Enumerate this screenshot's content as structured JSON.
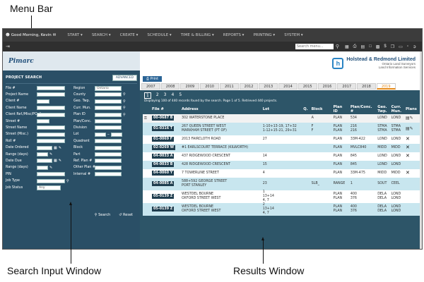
{
  "callouts": {
    "menu_bar": "Menu Bar",
    "search_input_window": "Search Input Window",
    "results_window": "Results Window"
  },
  "menubar": {
    "greeting": "Good Morning, Kevin",
    "items": [
      "Start",
      "Search",
      "Create",
      "Schedule",
      "Time & Billing",
      "Reports",
      "Printing",
      "System"
    ]
  },
  "toolbar": {
    "search_placeholder": "Search menu...",
    "icons": [
      "calendar-icon",
      "print-icon",
      "book-icon",
      "document-icon",
      "chart-icon",
      "dollar-icon",
      "copy-icon",
      "file-icon",
      "clipboard-icon",
      "logout-icon"
    ]
  },
  "left": {
    "logo_text": "Pimarc",
    "panel_title": "PROJECT SEARCH",
    "advanced_label": "ADVANCED",
    "fields_col1": [
      "File #",
      "Project Name",
      "Client #",
      "Client Name",
      "Client Ref./Misc/PO #",
      "Street #",
      "Street Name",
      "Street (Misc.)",
      "Roll #",
      "Date Ordered",
      "Range (days)",
      "Date Due",
      "Range (days)",
      "PIN",
      "Job Type",
      "Job Status"
    ],
    "fields_col2": [
      "Region",
      "County",
      "Geo. Twp.",
      "Curr. Mun.",
      "Plan ID",
      "Plan/Conc.",
      "Division",
      "Lot",
      "Quadrant",
      "Block",
      "Part",
      "Ref. Plan #",
      "Other Plan #",
      "Internal #"
    ],
    "region_value": "Ontario",
    "job_status_value": "Any",
    "search_label": "Search",
    "reset_label": "Reset"
  },
  "right": {
    "firm_name": "Holstead & Redmond Limited",
    "firm_line1": "Ontario Land Surveyors",
    "firm_line2": "Land Information Services",
    "print_label": "Print",
    "years": [
      "2007",
      "2008",
      "2009",
      "2010",
      "2011",
      "2012",
      "2013",
      "2014",
      "2015",
      "2016",
      "2017",
      "2018",
      "2019"
    ],
    "active_year": "2019",
    "pages": [
      "1",
      "2",
      "3",
      "4",
      "5"
    ],
    "display_count": "Displaying 100 of 440 records found by the search. Page 1 of 5. Retrieved 440 projects.",
    "columns": [
      "File #",
      "Address",
      "Lot",
      "Q.",
      "Block",
      "Plan ID",
      "Plan/Conc. #",
      "Geo. Twp.",
      "Curr. Mun.",
      "Plans"
    ],
    "rows": [
      {
        "file": "00-0687 B",
        "address": "302 WATERSTONE PLACE",
        "lot": "",
        "q": "",
        "block": "A",
        "plan_id": "PLAN",
        "plan_no": "534",
        "geo": "LOND",
        "mun": "LOND"
      },
      {
        "file": "01-0316 T",
        "address": "267 QUEEN STREET WEST\nMARKHAM STREET (PT OF)",
        "lot": "1-10+13-19, 17+32\n1-12+15-21, 29+31",
        "q": "",
        "block": "F\nF",
        "plan_id": "PLAN\nPLAN",
        "plan_no": "216\n216",
        "geo": "STMA\nSTMA",
        "mun": "STMA\nSTMA"
      },
      {
        "file": "01-0069 F",
        "address": "2013 FAIRCLOTH ROAD",
        "lot": "27",
        "q": "",
        "block": "",
        "plan_id": "PLAN",
        "plan_no": "33M-422",
        "geo": "LOND",
        "mun": "LOND"
      },
      {
        "file": "02-0269 W",
        "address": "#1 EARLSCOURT TERRACE (KILWORTH)",
        "lot": "",
        "q": "",
        "block": "",
        "plan_id": "PLAN",
        "plan_no": "MVLC840",
        "geo": "MIDD",
        "mun": "MIDD"
      },
      {
        "file": "04-0033 A",
        "address": "437 RIDGEWOOD CRESCENT",
        "lot": "14",
        "q": "",
        "block": "",
        "plan_id": "PLAN",
        "plan_no": "845",
        "geo": "LOND",
        "mun": "LOND"
      },
      {
        "file": "04-0033 B",
        "address": "428 RIDGEWOOD CRESCENT",
        "lot": "15",
        "q": "",
        "block": "",
        "plan_id": "PLAN",
        "plan_no": "845",
        "geo": "LOND",
        "mun": "LOND"
      },
      {
        "file": "04-0060 Y",
        "address": "7 TOWERLINE STREET",
        "lot": "4",
        "q": "",
        "block": "",
        "plan_id": "PLAN",
        "plan_no": "33M-475",
        "geo": "MIDD",
        "mun": "MIDD"
      },
      {
        "file": "04-0085 A",
        "address": "588+592 GEORGE STREET\nPORT STANLEY",
        "lot": "23",
        "q": "",
        "block": "SLB_",
        "plan_id": "RANGE",
        "plan_no": "1",
        "geo": "SOUT",
        "mun": "CEEL"
      },
      {
        "file": "05-0139 Z",
        "address": "WESTDEL BOURNE\nOXFORD STREET WEST",
        "lot": "1\n13+14\n4, 7",
        "q": "",
        "block": "",
        "plan_id": "PLAN\nPLAN",
        "plan_no": "400\n376",
        "geo": "DELA\nDELA",
        "mun": "LOND\nLOND"
      },
      {
        "file": "05-0139 Z",
        "address": "WESTDEL BOURNE\nOXFORD STREET WEST",
        "lot": "2\n13+14\n4, 7",
        "q": "",
        "block": "",
        "plan_id": "PLAN\nPLAN",
        "plan_no": "400\n376",
        "geo": "DELA\nDELA",
        "mun": "LOND\nLOND"
      }
    ]
  }
}
